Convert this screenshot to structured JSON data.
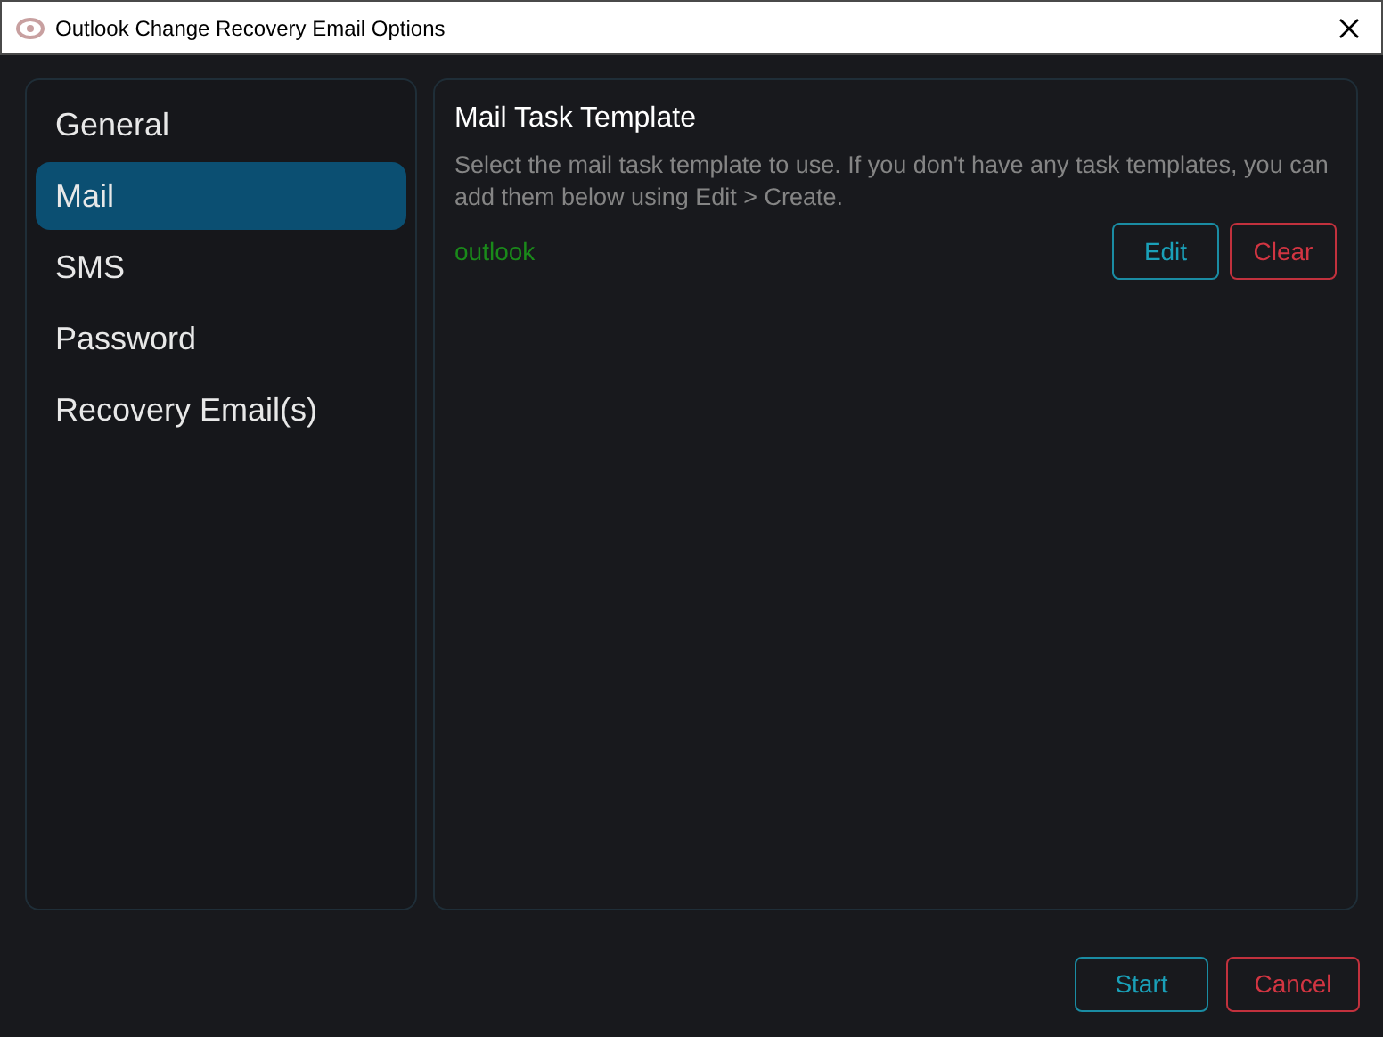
{
  "window": {
    "title": "Outlook Change Recovery Email Options"
  },
  "sidebar": {
    "items": [
      {
        "label": "General",
        "selected": false
      },
      {
        "label": "Mail",
        "selected": true
      },
      {
        "label": "SMS",
        "selected": false
      },
      {
        "label": "Password",
        "selected": false
      },
      {
        "label": "Recovery Email(s)",
        "selected": false
      }
    ]
  },
  "panel": {
    "title": "Mail Task Template",
    "description": "Select the mail task template to use. If you don't have any task templates, you can add them below using Edit > Create.",
    "selected_template": "outlook",
    "buttons": [
      {
        "label": "Edit",
        "kind": "primary"
      },
      {
        "label": "Clear",
        "kind": "danger"
      }
    ]
  },
  "footer": {
    "buttons": [
      {
        "label": "Start",
        "kind": "primary"
      },
      {
        "label": "Cancel",
        "kind": "danger"
      }
    ]
  }
}
